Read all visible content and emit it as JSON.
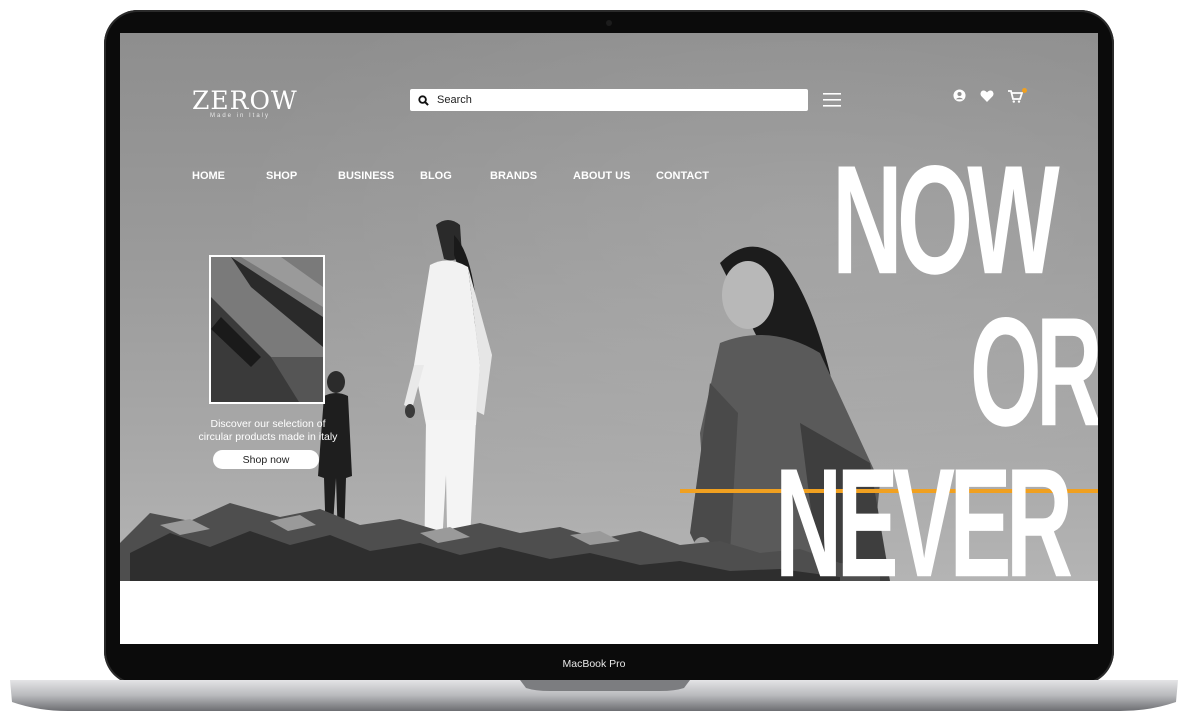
{
  "device": {
    "label": "MacBook Pro"
  },
  "header": {
    "logo_text": "ZEROW",
    "logo_tagline": "Made in Italy",
    "search_placeholder": "Search",
    "icons": [
      "search-icon",
      "menu-icon",
      "user-icon",
      "heart-icon",
      "cart-icon"
    ]
  },
  "nav": {
    "items": [
      {
        "label": "HOME"
      },
      {
        "label": "SHOP"
      },
      {
        "label": "BUSINESS"
      },
      {
        "label": "BLOG"
      },
      {
        "label": "BRANDS"
      },
      {
        "label": "ABOUT US"
      },
      {
        "label": "CONTACT"
      }
    ]
  },
  "hero": {
    "headline": [
      "NOW",
      "OR",
      "NEVER"
    ],
    "promo_text_line1": "Discover our selection of",
    "promo_text_line2": "circular products made in italy",
    "cta_label": "Shop now"
  },
  "colors": {
    "accent": "#f0a020",
    "text_light": "#ffffff",
    "bezel": "#0b0b0b"
  }
}
